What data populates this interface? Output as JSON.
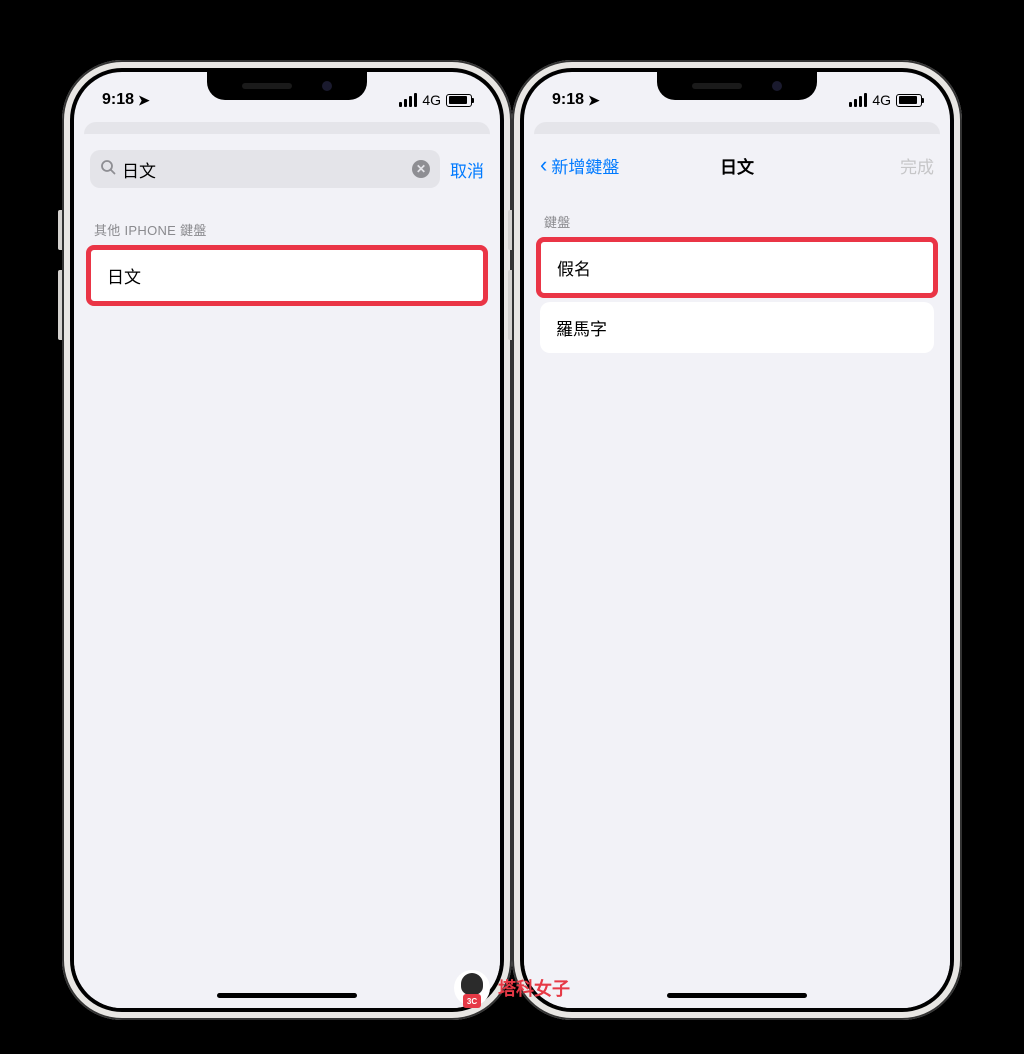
{
  "status": {
    "time": "9:18",
    "network": "4G"
  },
  "left": {
    "search": {
      "value": "日文",
      "cancel": "取消"
    },
    "section_header": "其他 IPHONE 鍵盤",
    "item": "日文"
  },
  "right": {
    "nav": {
      "back": "新增鍵盤",
      "title": "日文",
      "done": "完成"
    },
    "section_header": "鍵盤",
    "items": [
      "假名",
      "羅馬字"
    ]
  },
  "watermark": {
    "badge": "3C",
    "text": "塔科女子"
  }
}
